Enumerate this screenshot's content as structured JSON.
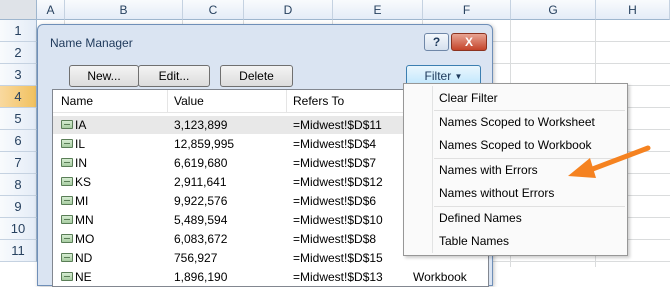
{
  "sheet": {
    "columns": [
      "A",
      "B",
      "C",
      "D",
      "E",
      "F",
      "G",
      "H"
    ],
    "rows": [
      "1",
      "2",
      "3",
      "4",
      "5",
      "6",
      "7",
      "8",
      "9",
      "10",
      "11"
    ],
    "active_row": "4"
  },
  "dialog": {
    "title": "Name Manager",
    "help_label": "?",
    "close_label": "X",
    "buttons": {
      "new": "New...",
      "edit": "Edit...",
      "delete": "Delete",
      "filter": "Filter"
    },
    "columns": {
      "name": "Name",
      "value": "Value",
      "refers_to": "Refers To"
    },
    "names": [
      {
        "name": "IA",
        "value": "3,123,899",
        "refers_to": "=Midwest!$D$11",
        "scope": ""
      },
      {
        "name": "IL",
        "value": "12,859,995",
        "refers_to": "=Midwest!$D$4",
        "scope": ""
      },
      {
        "name": "IN",
        "value": "6,619,680",
        "refers_to": "=Midwest!$D$7",
        "scope": ""
      },
      {
        "name": "KS",
        "value": "2,911,641",
        "refers_to": "=Midwest!$D$12",
        "scope": ""
      },
      {
        "name": "MI",
        "value": "9,922,576",
        "refers_to": "=Midwest!$D$6",
        "scope": ""
      },
      {
        "name": "MN",
        "value": "5,489,594",
        "refers_to": "=Midwest!$D$10",
        "scope": ""
      },
      {
        "name": "MO",
        "value": "6,083,672",
        "refers_to": "=Midwest!$D$8",
        "scope": ""
      },
      {
        "name": "ND",
        "value": "756,927",
        "refers_to": "=Midwest!$D$15",
        "scope": ""
      },
      {
        "name": "NE",
        "value": "1,896,190",
        "refers_to": "=Midwest!$D$13",
        "scope": "Workbook"
      }
    ]
  },
  "filter_menu": {
    "items": {
      "clear": "Clear Filter",
      "worksheet": "Names Scoped to Worksheet",
      "workbook": "Names Scoped to Workbook",
      "with_errors": "Names with Errors",
      "without_errors": "Names without Errors",
      "defined": "Defined Names",
      "table": "Table Names"
    }
  },
  "annotation": {
    "arrow_color": "#f58220"
  }
}
